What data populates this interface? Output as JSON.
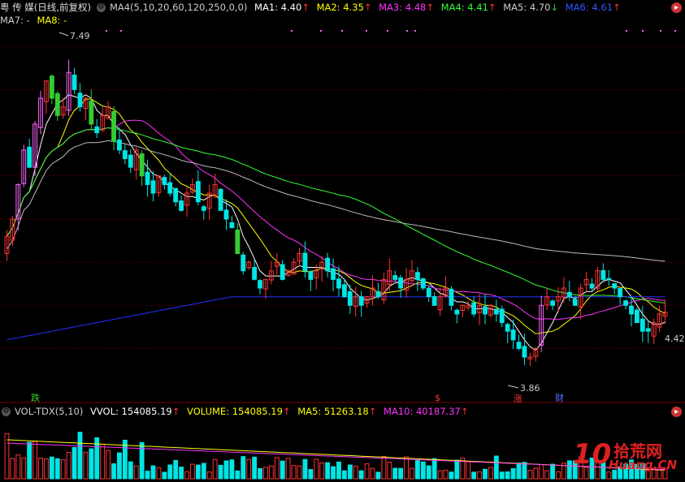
{
  "header": {
    "stock_name": "粤 传 媒(日线,前复权)",
    "indicator": "MA4(5,10,20,60,120,250,0,0)",
    "ma1": {
      "label": "MA1: 4.40",
      "arrow": "↑",
      "color": "#ffffff"
    },
    "ma2": {
      "label": "MA2: 4.35",
      "arrow": "↑",
      "color": "#ffff00"
    },
    "ma3": {
      "label": "MA3: 4.48",
      "arrow": "↑",
      "color": "#ff33ff"
    },
    "ma4": {
      "label": "MA4: 4.41",
      "arrow": "↑",
      "color": "#33ff33"
    },
    "ma5": {
      "label": "MA5: 4.70",
      "arrow": "↓",
      "color": "#cccccc"
    },
    "ma6": {
      "label": "MA6: 4.61",
      "arrow": "↑",
      "color": "#3333ff"
    }
  },
  "ma78": {
    "ma7": "MA7: -",
    "ma8": "MA8: -"
  },
  "volume_header": {
    "indicator": "VOL-TDX(5,10)",
    "vvol": "VVOL: 154085.19",
    "volume": "VOLUME: 154085.19",
    "ma5": "MA5: 51263.18",
    "ma10": "MA10: 40187.37",
    "arrow": "↑"
  },
  "annotations": {
    "high": "7.49",
    "low": "3.86",
    "last": "4.42",
    "marker_die": "跌",
    "marker_dollar": "$",
    "marker_zhang": "涨",
    "marker_cai": "财"
  },
  "watermark": {
    "num": "10",
    "cn": "拾荒网",
    "url": "Huang.CN"
  },
  "colors": {
    "up": "#ff3333",
    "down": "#00e5e5",
    "up_big": "#ff66ff",
    "down_big": "#33cc33"
  },
  "chart_data": {
    "type": "candlestick",
    "price_range": [
      3.6,
      7.7
    ],
    "annotated_high": 7.49,
    "annotated_low": 3.86,
    "annotated_last": 4.42,
    "close_path": [
      5.3,
      5.5,
      5.9,
      6.3,
      6.1,
      6.6,
      6.9,
      7.1,
      6.9,
      6.7,
      6.8,
      7.2,
      7.0,
      6.8,
      6.9,
      6.6,
      6.5,
      6.7,
      6.8,
      6.4,
      6.3,
      6.2,
      6.1,
      6.3,
      6.0,
      5.9,
      5.8,
      6.0,
      5.9,
      5.8,
      5.7,
      5.6,
      5.8,
      5.9,
      5.7,
      5.6,
      5.8,
      5.9,
      5.6,
      5.5,
      5.4,
      5.1,
      4.9,
      5.0,
      4.8,
      4.7,
      4.8,
      4.9,
      5.0,
      4.8,
      4.9,
      5.0,
      5.1,
      4.9,
      4.8,
      4.9,
      5.0,
      4.9,
      4.8,
      4.7,
      4.6,
      4.5,
      4.6,
      4.5,
      4.6,
      4.7,
      4.6,
      4.8,
      4.9,
      4.8,
      4.7,
      4.8,
      4.9,
      4.8,
      4.7,
      4.6,
      4.5,
      4.6,
      4.7,
      4.5,
      4.4,
      4.5,
      4.5,
      4.4,
      4.5,
      4.4,
      4.5,
      4.4,
      4.3,
      4.2,
      4.1,
      4.0,
      3.9,
      3.9,
      4.0,
      4.5,
      4.6,
      4.5,
      4.6,
      4.7,
      4.6,
      4.5,
      4.7,
      4.8,
      4.7,
      4.9,
      4.8,
      4.8,
      4.7,
      4.6,
      4.5,
      4.4,
      4.3,
      4.2,
      4.2,
      4.3,
      4.4,
      4.42
    ]
  }
}
